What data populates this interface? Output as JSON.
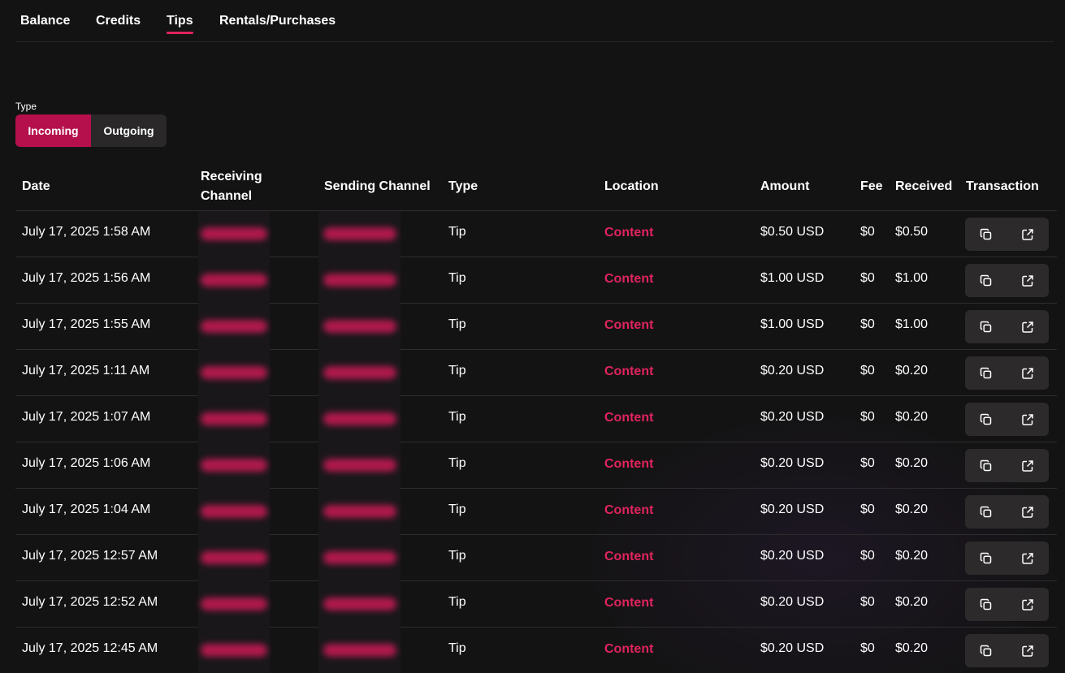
{
  "tabs": [
    {
      "label": "Balance",
      "active": false
    },
    {
      "label": "Credits",
      "active": false
    },
    {
      "label": "Tips",
      "active": true
    },
    {
      "label": "Rentals/Purchases",
      "active": false
    }
  ],
  "filter": {
    "label": "Type",
    "options": [
      "Incoming",
      "Outgoing"
    ],
    "selected": "Incoming"
  },
  "table": {
    "headers": {
      "date": "Date",
      "receiving_channel_line1": "Receiving",
      "receiving_channel_line2": "Channel",
      "sending_channel": "Sending Channel",
      "type": "Type",
      "location": "Location",
      "amount": "Amount",
      "fee": "Fee",
      "received": "Received",
      "transaction": "Transaction"
    },
    "rows": [
      {
        "date": "July 17, 2025 1:58 AM",
        "type": "Tip",
        "location": "Content",
        "amount": "$0.50 USD",
        "fee": "$0",
        "received": "$0.50"
      },
      {
        "date": "July 17, 2025 1:56 AM",
        "type": "Tip",
        "location": "Content",
        "amount": "$1.00 USD",
        "fee": "$0",
        "received": "$1.00"
      },
      {
        "date": "July 17, 2025 1:55 AM",
        "type": "Tip",
        "location": "Content",
        "amount": "$1.00 USD",
        "fee": "$0",
        "received": "$1.00"
      },
      {
        "date": "July 17, 2025 1:11 AM",
        "type": "Tip",
        "location": "Content",
        "amount": "$0.20 USD",
        "fee": "$0",
        "received": "$0.20"
      },
      {
        "date": "July 17, 2025 1:07 AM",
        "type": "Tip",
        "location": "Content",
        "amount": "$0.20 USD",
        "fee": "$0",
        "received": "$0.20"
      },
      {
        "date": "July 17, 2025 1:06 AM",
        "type": "Tip",
        "location": "Content",
        "amount": "$0.20 USD",
        "fee": "$0",
        "received": "$0.20"
      },
      {
        "date": "July 17, 2025 1:04 AM",
        "type": "Tip",
        "location": "Content",
        "amount": "$0.20 USD",
        "fee": "$0",
        "received": "$0.20"
      },
      {
        "date": "July 17, 2025 12:57 AM",
        "type": "Tip",
        "location": "Content",
        "amount": "$0.20 USD",
        "fee": "$0",
        "received": "$0.20"
      },
      {
        "date": "July 17, 2025 12:52 AM",
        "type": "Tip",
        "location": "Content",
        "amount": "$0.20 USD",
        "fee": "$0",
        "received": "$0.20"
      },
      {
        "date": "July 17, 2025 12:45 AM",
        "type": "Tip",
        "location": "Content",
        "amount": "$0.20 USD",
        "fee": "$0",
        "received": "$0.20"
      }
    ]
  },
  "icons": {
    "copy": "copy-icon",
    "external_link": "external-link-icon"
  },
  "colors": {
    "accent": "#e0245e",
    "selected_segment": "#b5104b",
    "background": "#141314"
  }
}
